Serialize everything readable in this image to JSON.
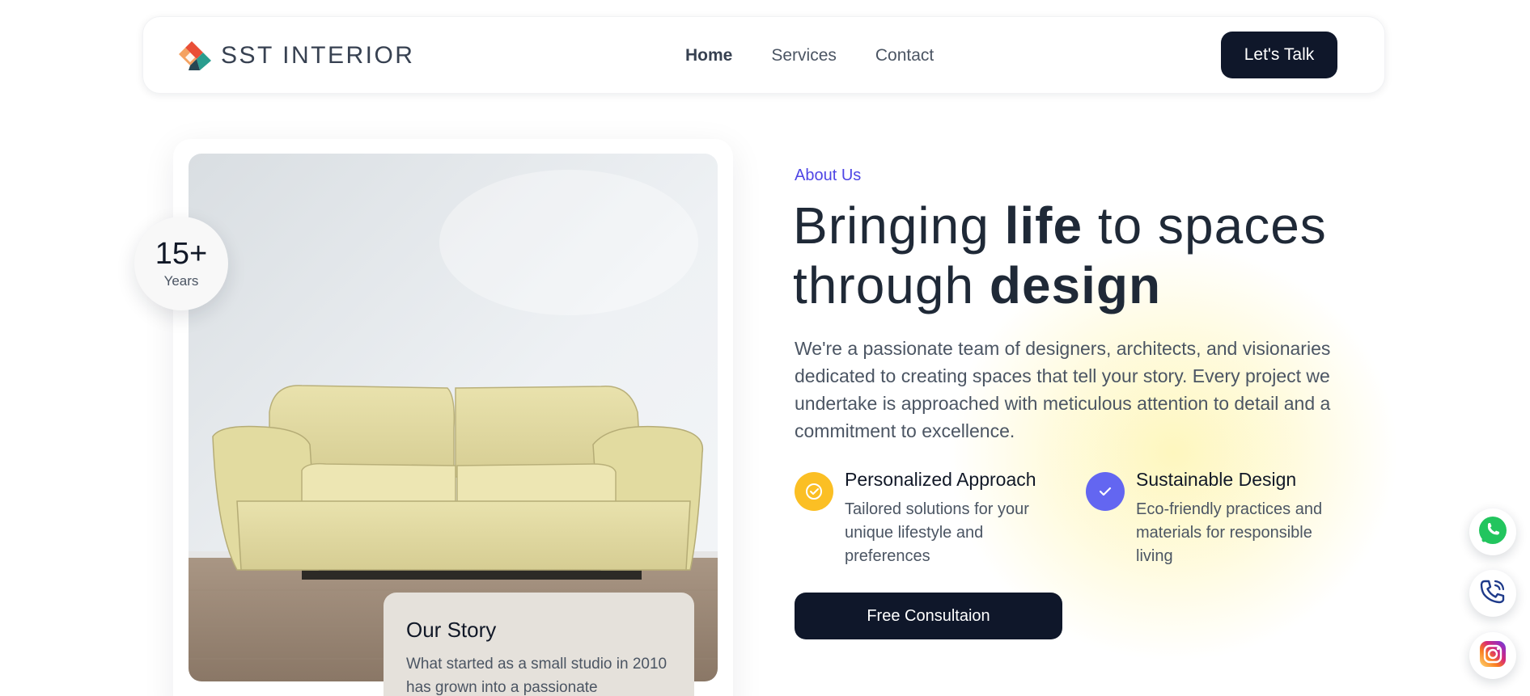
{
  "brand": {
    "name": "SST INTERIOR"
  },
  "nav": {
    "links": [
      {
        "label": "Home",
        "active": true
      },
      {
        "label": "Services",
        "active": false
      },
      {
        "label": "Contact",
        "active": false
      }
    ],
    "cta_label": "Let's Talk"
  },
  "about": {
    "badge": {
      "value": "15+",
      "label": "Years"
    },
    "story": {
      "title": "Our Story",
      "text": "What started as a small studio in 2010 has grown into a passionate"
    },
    "eyebrow": "About Us",
    "headline": {
      "part1": "Bringing ",
      "bold1": "life",
      "part2": " to spaces through ",
      "bold2": "design"
    },
    "intro": "We're a passionate team of designers, architects, and visionaries dedicated to creating spaces that tell your story. Every project we undertake is approached with meticulous attention to detail and a commitment to excellence.",
    "features": [
      {
        "icon": "check-circle-icon",
        "title": "Personalized Approach",
        "description": "Tailored solutions for your unique lifestyle and preferences",
        "color": "#fbbf24"
      },
      {
        "icon": "check-icon",
        "title": "Sustainable Design",
        "description": "Eco-friendly practices and materials for responsible living",
        "color": "#6366f1"
      }
    ],
    "cta_label": "Free Consultaion"
  },
  "social": [
    {
      "icon": "whatsapp-icon",
      "color": "#22c55e"
    },
    {
      "icon": "phone-icon",
      "color": "#1e3a8a"
    },
    {
      "icon": "instagram-icon",
      "color": "#e1306c"
    }
  ],
  "colors": {
    "accent": "#4f46e5",
    "dark": "#0f172a",
    "yellow": "#fbbf24",
    "purple": "#6366f1"
  }
}
